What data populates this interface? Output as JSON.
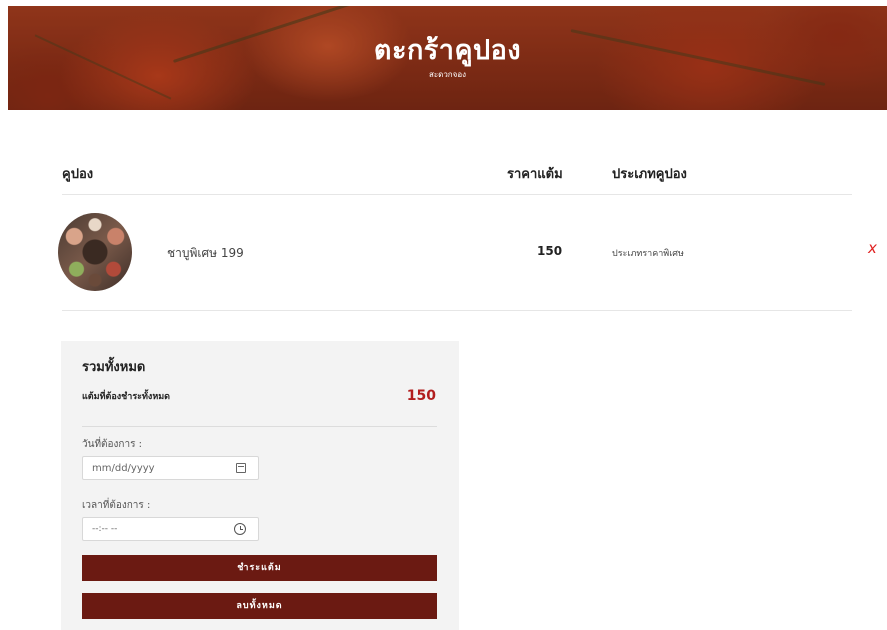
{
  "hero": {
    "title": "ตะกร้าคูปอง",
    "subtitle": "สะดวกจอง"
  },
  "table": {
    "headers": {
      "coupon": "คูปอง",
      "price": "ราคาแต้ม",
      "type": "ประเภทคูปอง"
    },
    "rows": [
      {
        "name": "ชาบูพิเศษ 199",
        "price": "150",
        "type": "ประเภทราคาพิเศษ",
        "remove": "x"
      }
    ]
  },
  "summary": {
    "title": "รวมทั้งหมด",
    "total_label": "แต้มที่ต้องชำระทั้งหมด",
    "total_value": "150",
    "date_label": "วันที่ต้องการ :",
    "date_placeholder": "mm/dd/yyyy",
    "time_label": "เวลาที่ต้องการ :",
    "time_placeholder": "--:-- --",
    "pay_button": "ชำระแต้ม",
    "clear_button": "ลบทั้งหมด"
  },
  "colors": {
    "accent": "#6b1a12",
    "total": "#b21e1e",
    "remove": "#e02020"
  },
  "icons": {
    "calendar": "calendar-icon",
    "clock": "clock-icon",
    "remove": "close-icon"
  }
}
